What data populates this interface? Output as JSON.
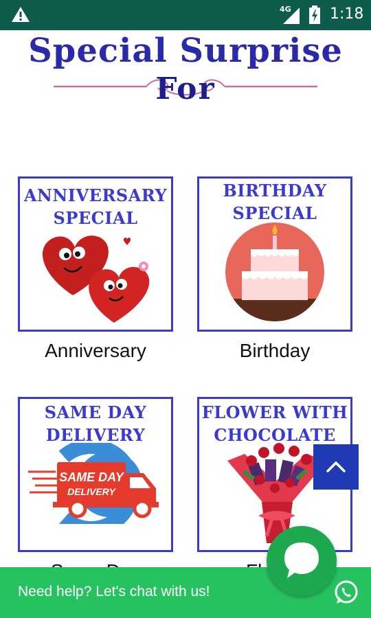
{
  "status_bar": {
    "network": "4G",
    "time": "1:18",
    "icons": [
      "warning-icon",
      "signal-icon",
      "battery-charging-icon"
    ]
  },
  "header": {
    "title": "Special Surprise",
    "subtitle": "For"
  },
  "cards": [
    {
      "heading_line1": "ANNIVERSARY",
      "heading_line2": "SPECIAL",
      "label": "Anniversary",
      "icon": "hearts-icon"
    },
    {
      "heading_line1": "BIRTHDAY",
      "heading_line2": "SPECIAL",
      "label": "Birthday",
      "icon": "cake-icon"
    },
    {
      "heading_line1": "SAME DAY",
      "heading_line2": "DELIVERY",
      "label": "Same Day",
      "art_line1": "SAME DAY",
      "art_line2": "DELIVERY",
      "icon": "delivery-truck-icon"
    },
    {
      "heading_line1": "FLOWER WITH",
      "heading_line2": "CHOCOLATE",
      "label": "Flower",
      "icon": "bouquet-icon"
    }
  ],
  "scroll_top": {
    "icon": "chevron-up-icon"
  },
  "chat": {
    "icon": "chat-bubble-icon"
  },
  "help_bar": {
    "text": "Need help? Let's chat with us!",
    "icon": "whatsapp-icon"
  },
  "colors": {
    "status_bar": "#0d5c4c",
    "title": "#2a2aa8",
    "card_border": "#3a3ad0",
    "scroll_button": "#1f3bb3",
    "chat_green": "#27c260"
  }
}
